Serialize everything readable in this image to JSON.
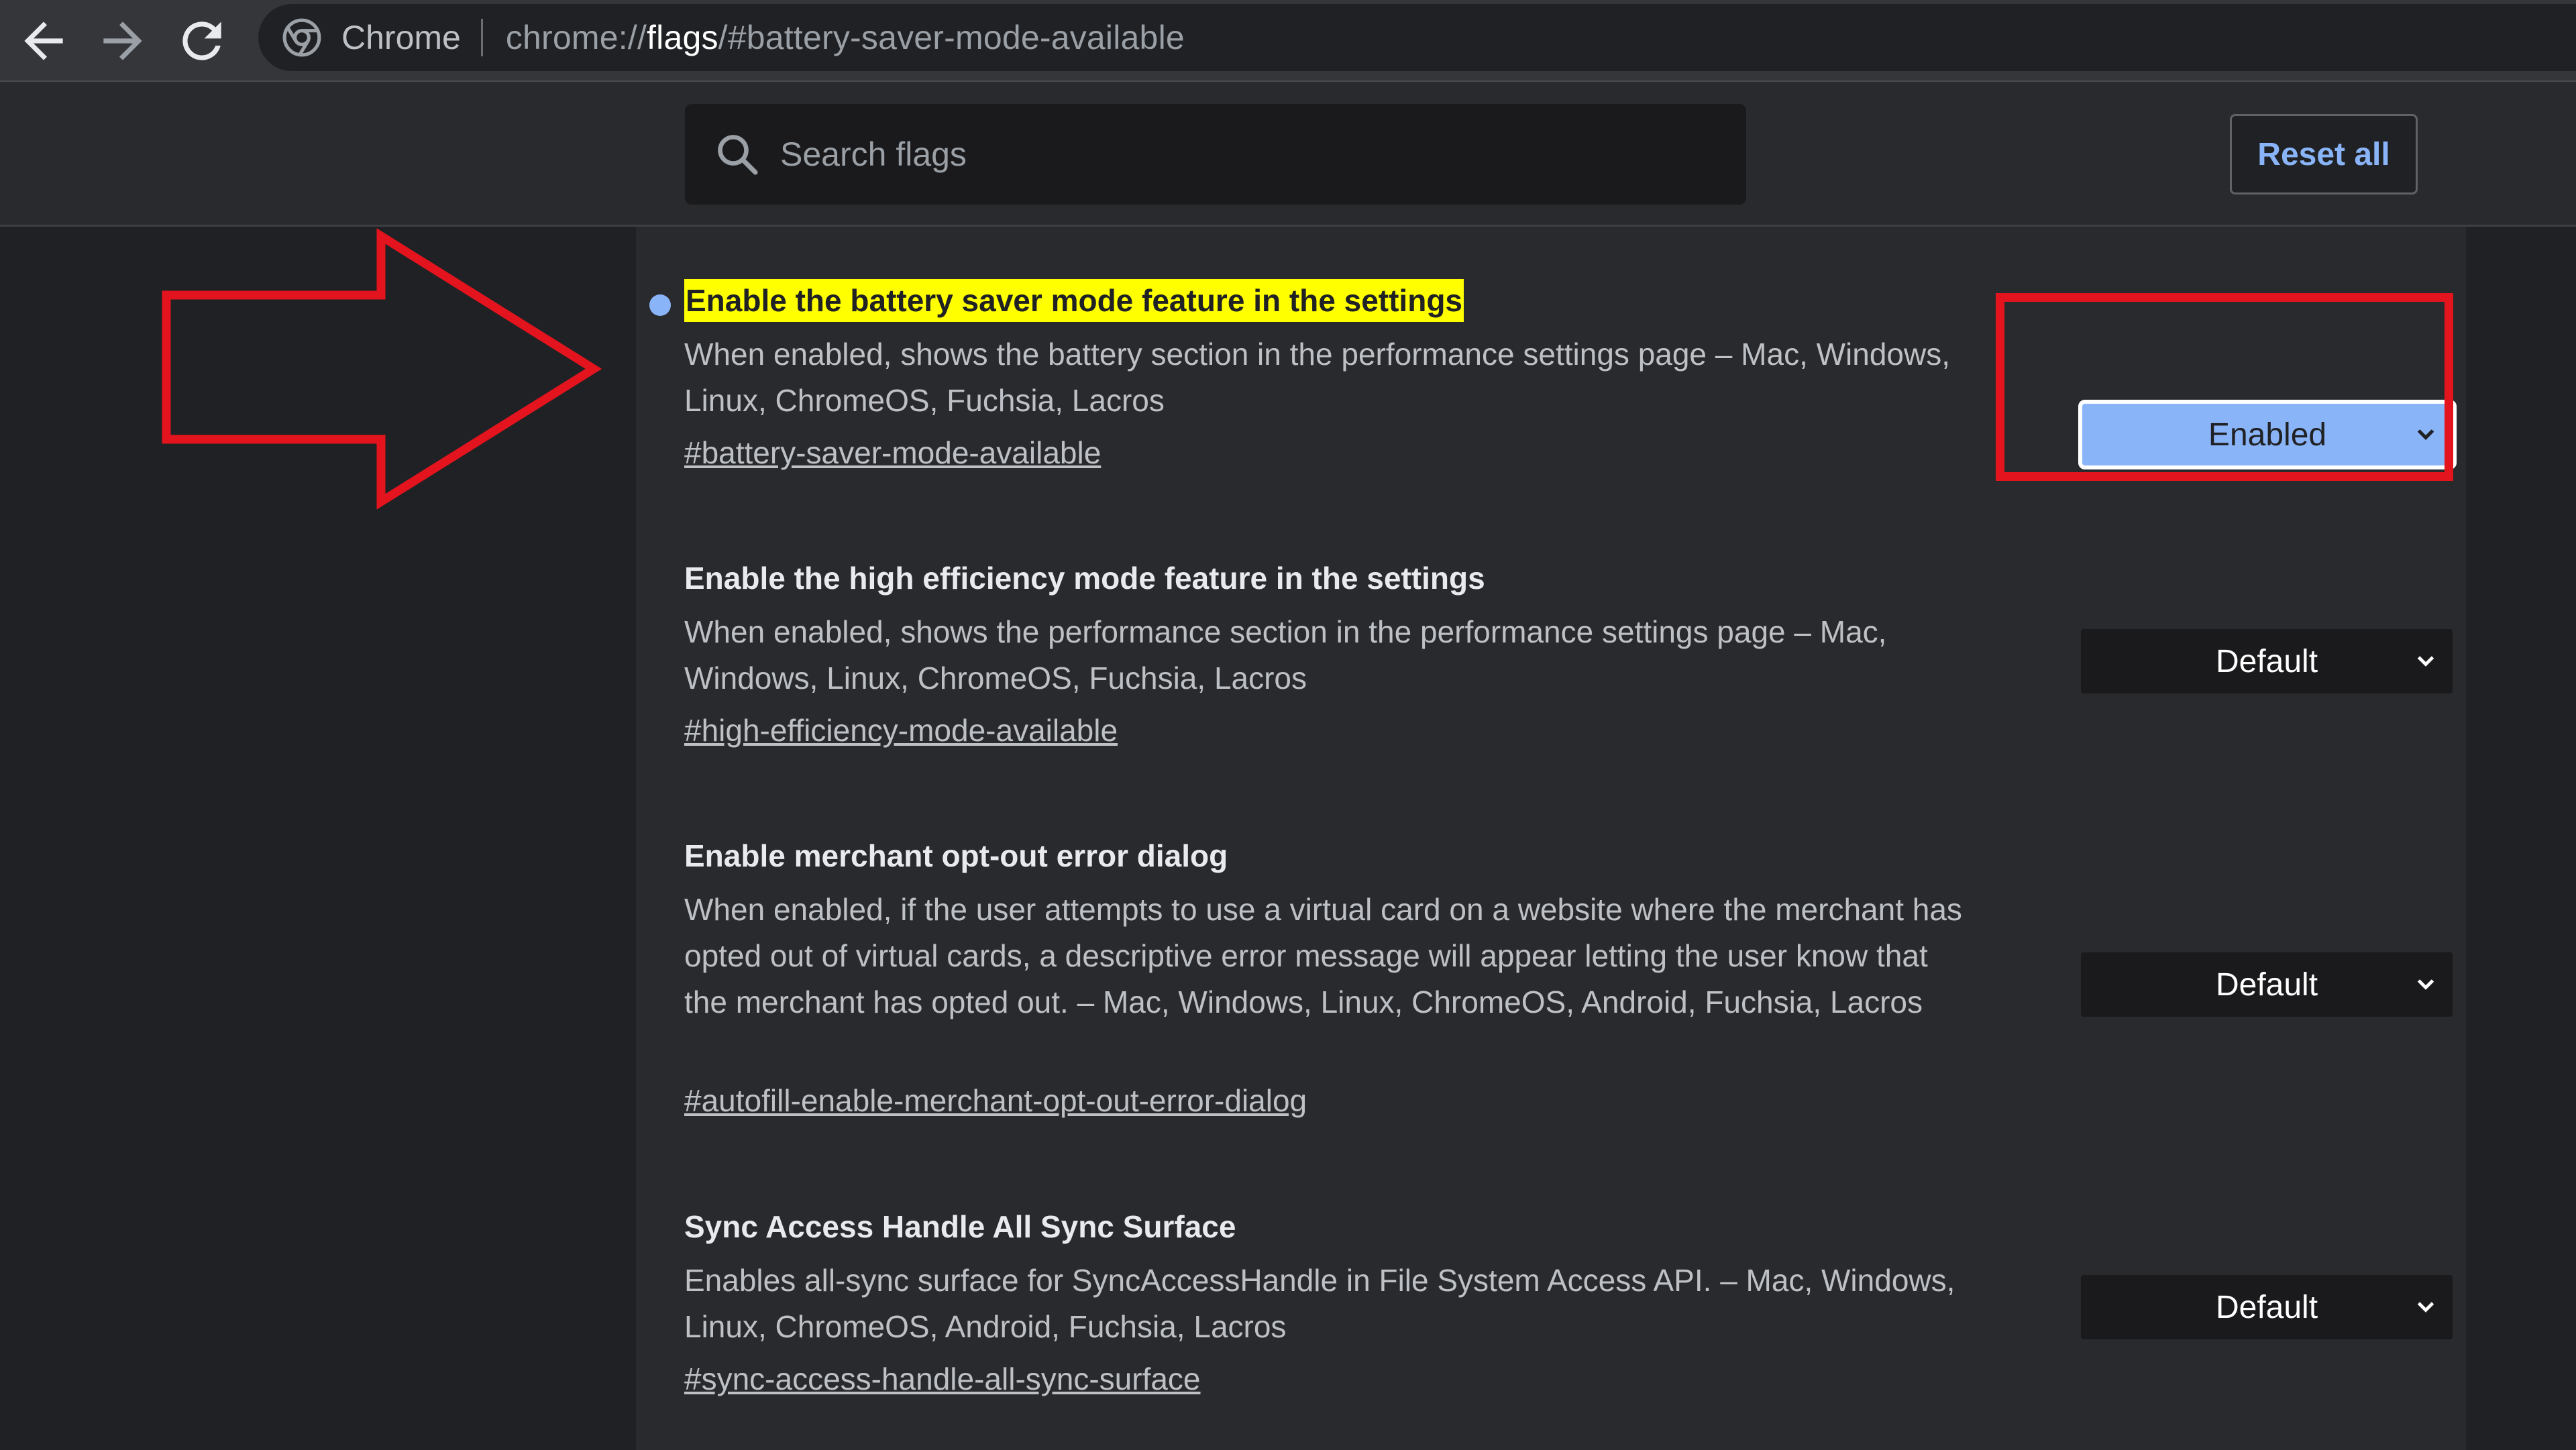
{
  "browser": {
    "chip_label": "Chrome",
    "url_scheme": "chrome://",
    "url_host": "flags",
    "url_path": "/#battery-saver-mode-available",
    "icons": [
      "back-icon",
      "forward-icon",
      "reload-icon",
      "chrome-logo-icon"
    ]
  },
  "header": {
    "search_placeholder": "Search flags",
    "reset_label": "Reset all"
  },
  "flags": [
    {
      "title": "Enable the battery saver mode feature in the settings",
      "description": "When enabled, shows the battery section in the performance settings page – Mac, Windows, Linux, ChromeOS, Fuchsia, Lacros",
      "link": "#battery-saver-mode-available",
      "value": "Enabled",
      "highlighted": true
    },
    {
      "title": "Enable the high efficiency mode feature in the settings",
      "description": "When enabled, shows the performance section in the performance settings page – Mac, Windows, Linux, ChromeOS, Fuchsia, Lacros",
      "link": "#high-efficiency-mode-available",
      "value": "Default"
    },
    {
      "title": "Enable merchant opt-out error dialog",
      "description": "When enabled, if the user attempts to use a virtual card on a website where the merchant has opted out of virtual cards, a descriptive error message will appear letting the user know that the merchant has opted out. – Mac, Windows, Linux, ChromeOS, Android, Fuchsia, Lacros",
      "link": "#autofill-enable-merchant-opt-out-error-dialog",
      "value": "Default"
    },
    {
      "title": "Sync Access Handle All Sync Surface",
      "description": "Enables all-sync surface for SyncAccessHandle in File System Access API. – Mac, Windows, Linux, ChromeOS, Android, Fuchsia, Lacros",
      "link": "#sync-access-handle-all-sync-surface",
      "value": "Default"
    }
  ],
  "colors": {
    "annotation_red": "#e4141e",
    "highlight_yellow": "#ffff00",
    "enabled_blue": "#8ab4f8"
  }
}
